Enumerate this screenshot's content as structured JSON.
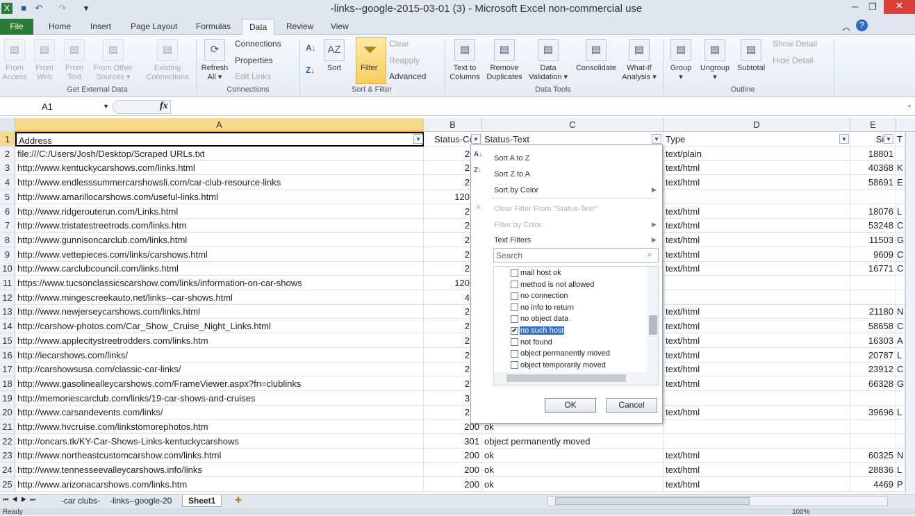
{
  "window": {
    "title": "-links--google-2015-03-01 (3)  -  Microsoft Excel non-commercial use",
    "close": "✕",
    "minimize": "─",
    "restore": "❐"
  },
  "tabs": [
    "File",
    "Home",
    "Insert",
    "Page Layout",
    "Formulas",
    "Data",
    "Review",
    "View"
  ],
  "active_tab": "Data",
  "ribbon": {
    "get_external": {
      "label": "Get External Data",
      "buttons": [
        "From\nAccess",
        "From\nWeb",
        "From\nText",
        "From Other\nSources ▾",
        "Existing\nConnections"
      ]
    },
    "connections": {
      "label": "Connections",
      "refresh": "Refresh\nAll ▾",
      "connections": "Connections",
      "properties": "Properties",
      "edit_links": "Edit Links"
    },
    "sort_filter": {
      "label": "Sort & Filter",
      "sort": "Sort",
      "filter": "Filter",
      "clear": "Clear",
      "reapply": "Reapply",
      "advanced": "Advanced"
    },
    "data_tools": {
      "label": "Data Tools",
      "buttons": [
        "Text to\nColumns",
        "Remove\nDuplicates",
        "Data\nValidation ▾",
        "Consolidate",
        "What-If\nAnalysis ▾"
      ]
    },
    "outline": {
      "label": "Outline",
      "buttons": [
        "Group\n▾",
        "Ungroup\n▾",
        "Subtotal"
      ],
      "show_detail": "Show Detail",
      "hide_detail": "Hide Detail"
    }
  },
  "formula_bar": {
    "name_box": "A1",
    "fx": "fx",
    "value": ""
  },
  "columns": [
    "A",
    "B",
    "C",
    "D",
    "E"
  ],
  "colors": {
    "accent": "#2a7b35",
    "selection": "#f9d98d",
    "highlight": "#3572c6"
  },
  "rows": [
    [
      "1",
      "Address",
      "Status-Cod",
      "Status-Text",
      "Type",
      "Size",
      "T"
    ],
    [
      "2",
      "file:///C:/Users/Josh/Desktop/Scraped URLs.txt",
      "2",
      "",
      "text/plain",
      "18801",
      ""
    ],
    [
      "3",
      "http://www.kentuckycarshows.com/links.html",
      "2",
      "",
      "text/html",
      "40368",
      "K"
    ],
    [
      "4",
      "http://www.endlesssummercarshowsli.com/car-club-resource-links",
      "2",
      "",
      "text/html",
      "58691",
      "E"
    ],
    [
      "5",
      "http://www.amarillocarshows.com/useful-links.html",
      "120",
      "",
      "",
      "",
      ""
    ],
    [
      "6",
      "http://www.ridgerouterun.com/Links.html",
      "2",
      "",
      "text/html",
      "18076",
      "L"
    ],
    [
      "7",
      "http://www.tristatestreetrods.com/links.htm",
      "2",
      "",
      "text/html",
      "53248",
      "C"
    ],
    [
      "8",
      "http://www.gunnisoncarclub.com/links.html",
      "2",
      "",
      "text/html",
      "11503",
      "G"
    ],
    [
      "9",
      "http://www.vettepieces.com/links/carshows.html",
      "2",
      "",
      "text/html",
      "9609",
      "C"
    ],
    [
      "10",
      "http://www.carclubcouncil.com/links.html",
      "2",
      "",
      "text/html",
      "16771",
      "C"
    ],
    [
      "11",
      "https://www.tucsonclassicscarshow.com/links/information-on-car-shows",
      "120",
      "",
      "",
      "",
      ""
    ],
    [
      "12",
      "http://www.mingescreekauto.net/links--car-shows.html",
      "4",
      "",
      "",
      "",
      ""
    ],
    [
      "13",
      "http://www.newjerseycarshows.com/links.html",
      "2",
      "",
      "text/html",
      "21180",
      "N"
    ],
    [
      "14",
      "http://carshow-photos.com/Car_Show_Cruise_Night_Links.html",
      "2",
      "",
      "text/html",
      "58658",
      "C"
    ],
    [
      "15",
      "http://www.applecitystreetrodders.com/links.htm",
      "2",
      "",
      "text/html",
      "16303",
      "A"
    ],
    [
      "16",
      "http://iecarshows.com/links/",
      "2",
      "",
      "text/html",
      "20787",
      "L"
    ],
    [
      "17",
      "http://carshowsusa.com/classic-car-links/",
      "2",
      "",
      "text/html",
      "23912",
      "C"
    ],
    [
      "18",
      "http://www.gasolinealleycarshows.com/FrameViewer.aspx?fn=clublinks",
      "2",
      "",
      "text/html",
      "66328",
      "G"
    ],
    [
      "19",
      "http://memoriescarclub.com/links/19-car-shows-and-cruises",
      "3",
      "",
      "",
      "",
      ""
    ],
    [
      "20",
      "http://www.carsandevents.com/links/",
      "2",
      "",
      "text/html",
      "39696",
      "L"
    ],
    [
      "21",
      "http://www.hvcruise.com/linkstomorephotos.htm",
      "200",
      "ok",
      "",
      "",
      ""
    ],
    [
      "22",
      "http://oncars.tk/KY-Car-Shows-Links-kentuckycarshows",
      "301",
      "object permanently moved",
      "",
      "",
      ""
    ],
    [
      "23",
      "http://www.northeastcustomcarshow.com/links.html",
      "200",
      "ok",
      "text/html",
      "60325",
      "N"
    ],
    [
      "24",
      "http://www.tennesseevalleycarshows.info/links",
      "200",
      "ok",
      "text/html",
      "28836",
      "L"
    ],
    [
      "25",
      "http://www.arizonacarshows.com/links.htm",
      "200",
      "ok",
      "text/html",
      "4469",
      "P"
    ]
  ],
  "filter_menu": {
    "sort_az": "Sort A to Z",
    "sort_za": "Sort Z to A",
    "sort_color": "Sort by Color",
    "clear_filter": "Clear Filter From \"Status-Text\"",
    "filter_color": "Filter by Color",
    "text_filters": "Text Filters",
    "search_placeholder": "Search",
    "items": [
      {
        "label": "mail host ok",
        "checked": false
      },
      {
        "label": "method is not allowed",
        "checked": false
      },
      {
        "label": "no connection",
        "checked": false
      },
      {
        "label": "no info to return",
        "checked": false
      },
      {
        "label": "no object data",
        "checked": false
      },
      {
        "label": "no such host",
        "checked": true
      },
      {
        "label": "not found",
        "checked": false
      },
      {
        "label": "object permanently moved",
        "checked": false
      },
      {
        "label": "object temporarily moved",
        "checked": false
      }
    ],
    "ok": "OK",
    "cancel": "Cancel"
  },
  "sheets": [
    "-car clubs-",
    "-links--google-20",
    "Sheet1"
  ],
  "active_sheet": "Sheet1",
  "status": {
    "text": "Ready",
    "zoom": "100%"
  }
}
